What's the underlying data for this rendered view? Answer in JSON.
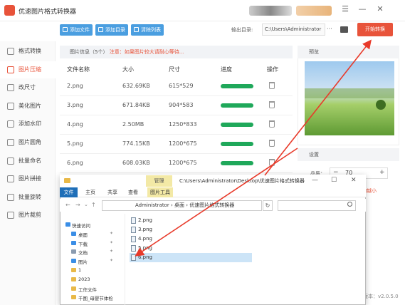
{
  "window": {
    "title": "优速图片格式转换器",
    "menu_icon": "☰",
    "min_icon": "—",
    "close_icon": "✕"
  },
  "toolbar": {
    "add_file": "添加文件",
    "add_folder": "添加目录",
    "clear_list": "清除列表",
    "output_label": "输出目录:",
    "output_path": "C:\\Users\\Administrator",
    "more": "···",
    "start_button": "开始转换"
  },
  "sidebar": {
    "items": [
      {
        "label": "格式转换"
      },
      {
        "label": "图片压缩"
      },
      {
        "label": "改尺寸"
      },
      {
        "label": "美化图片"
      },
      {
        "label": "添加水印"
      },
      {
        "label": "图片圆角"
      },
      {
        "label": "批量命名"
      },
      {
        "label": "图片拼接"
      },
      {
        "label": "批量旋转"
      },
      {
        "label": "图片裁剪"
      }
    ],
    "active_index": 1
  },
  "info": {
    "label": "图片信息（5个）",
    "warning": "注意：如果图片较大请耐心等待..."
  },
  "table": {
    "headers": [
      "文件名称",
      "大小",
      "尺寸",
      "进度",
      "操作"
    ],
    "rows": [
      {
        "name": "2.png",
        "size": "632.69KB",
        "dims": "615*529",
        "progress": 1.0
      },
      {
        "name": "3.png",
        "size": "671.84KB",
        "dims": "904*583",
        "progress": 1.0
      },
      {
        "name": "4.png",
        "size": "2.50MB",
        "dims": "1250*833",
        "progress": 1.0
      },
      {
        "name": "5.png",
        "size": "774.15KB",
        "dims": "1200*675",
        "progress": 1.0
      },
      {
        "name": "6.png",
        "size": "608.03KB",
        "dims": "1200*675",
        "progress": 1.0
      }
    ]
  },
  "preview": {
    "label": "预览"
  },
  "settings": {
    "label": "设置",
    "quality_label": "品质：",
    "quality_value": "70",
    "minus": "−",
    "plus": "+",
    "hint": "的越小"
  },
  "version": "版本：v2.0.5.0",
  "explorer": {
    "manage_tab": "管理",
    "path_title": "C:\\Users\\Administrator\\Desktop\\优速图片格式转换器",
    "ribbon_tabs": [
      "文件",
      "主页",
      "共享",
      "查看",
      "图片工具"
    ],
    "breadcrumb": "Administrator  ›  桌面  ›  优速图片格式转换器",
    "refresh": "↻",
    "nav_items": [
      {
        "label": "快速访问",
        "icon": "star-icon"
      },
      {
        "label": "桌面",
        "icon": "desktop-icon"
      },
      {
        "label": "下载",
        "icon": "download-icon"
      },
      {
        "label": "文档",
        "icon": "document-icon"
      },
      {
        "label": "图片",
        "icon": "picture-icon"
      },
      {
        "label": "1",
        "icon": "folder-icon"
      },
      {
        "label": "2023",
        "icon": "folder-icon"
      },
      {
        "label": "工作文件",
        "icon": "folder-icon"
      },
      {
        "label": "千图_母婴节体检",
        "icon": "folder-icon"
      }
    ],
    "files": [
      "2.png",
      "3.png",
      "4.png",
      "5.png",
      "6.png"
    ],
    "selected_file_index": 4
  },
  "colors": {
    "accent": "#e8533a",
    "progress": "#1fa85a",
    "toolbar_button": "#4a9ee0"
  }
}
